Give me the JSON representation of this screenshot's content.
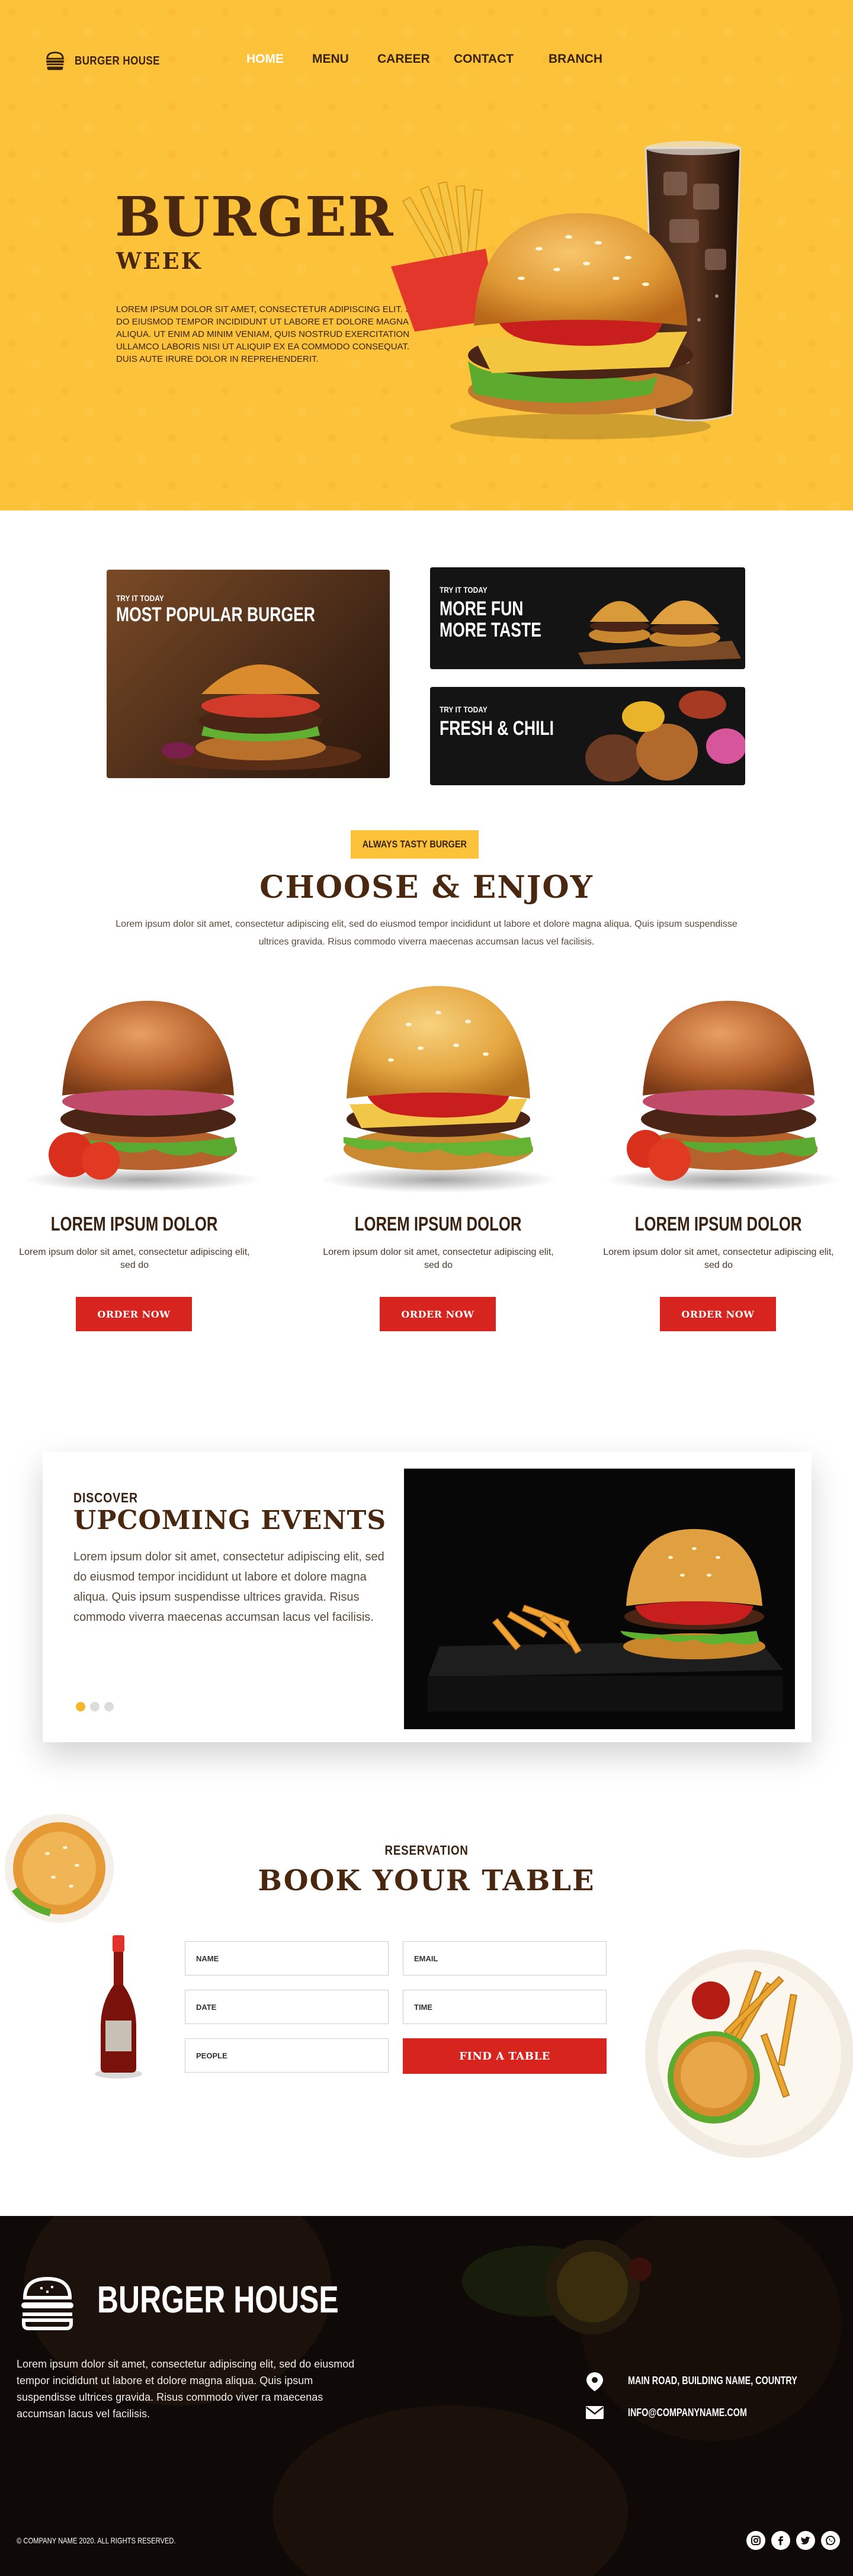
{
  "header": {
    "brand": "BURGER HOUSE",
    "nav": [
      {
        "label": "HOME",
        "active": true
      },
      {
        "label": "MENU",
        "active": false
      },
      {
        "label": "CAREER",
        "active": false
      },
      {
        "label": "CONTACT",
        "active": false
      },
      {
        "label": "BRANCH",
        "active": false
      }
    ]
  },
  "hero": {
    "title": "BURGER",
    "subtitle": "WEEK",
    "text": "LOREM IPSUM DOLOR SIT AMET, CONSECTETUR ADIPISCING ELIT. SED DO EIUSMOD TEMPOR INCIDIDUNT UT LABORE ET DOLORE MAGNA ALIQUA. UT ENIM AD MINIM VENIAM, QUIS NOSTRUD EXERCITATION ULLAMCO LABORIS NISI UT ALIQUIP EX EA COMMODO CONSEQUAT. DUIS AUTE IRURE DOLOR IN REPREHENDERIT."
  },
  "promos": [
    {
      "kicker": "TRY IT TODAY",
      "title": "MOST POPULAR BURGER"
    },
    {
      "kicker": "TRY IT TODAY",
      "title_line1": "MORE FUN",
      "title_line2": "MORE TASTE"
    },
    {
      "kicker": "TRY IT TODAY",
      "title": "FRESH & CHILI"
    }
  ],
  "choose": {
    "badge": "ALWAYS TASTY BURGER",
    "title": "CHOOSE & ENJOY",
    "text": "Lorem ipsum dolor sit amet, consectetur adipiscing elit, sed do eiusmod tempor incididunt ut labore et dolore magna aliqua. Quis ipsum suspendisse ultrices gravida. Risus commodo viverra maecenas accumsan lacus vel facilisis."
  },
  "products": [
    {
      "name": "LOREM IPSUM DOLOR",
      "desc": "Lorem ipsum dolor sit amet, consectetur adipiscing elit, sed do",
      "button": "ORDER NOW"
    },
    {
      "name": "LOREM IPSUM DOLOR",
      "desc": "Lorem ipsum dolor sit amet, consectetur adipiscing elit, sed do",
      "button": "ORDER NOW"
    },
    {
      "name": "LOREM IPSUM DOLOR",
      "desc": "Lorem ipsum dolor sit amet, consectetur adipiscing elit, sed do",
      "button": "ORDER NOW"
    }
  ],
  "events": {
    "kicker": "DISCOVER",
    "title": "UPCOMING EVENTS",
    "text": "Lorem ipsum dolor sit amet, consectetur adipiscing elit, sed do eiusmod tempor incididunt ut labore et dolore magna aliqua. Quis ipsum suspendisse ultrices gravida. Risus commodo viverra maecenas accumsan lacus vel facilisis.",
    "slides": 3,
    "active_slide": 1
  },
  "booking": {
    "kicker": "RESERVATION",
    "title": "BOOK YOUR TABLE",
    "fields": {
      "name": "NAME",
      "email": "EMAIL",
      "date": "DATE",
      "time": "TIME",
      "people": "PEOPLE"
    },
    "button": "FIND A TABLE"
  },
  "footer": {
    "brand": "BURGER HOUSE",
    "text": "Lorem ipsum dolor sit amet, consectetur adipiscing elit, sed do eiusmod tempor incididunt ut labore et dolore magna aliqua. Quis ipsum suspendisse ultrices gravida. Risus commodo viver ra maecenas accumsan lacus vel facilisis.",
    "address": "MAIN ROAD, BUILDING NAME, COUNTRY",
    "email": "INFO@COMPANYNAME.COM",
    "copyright": "© COMPANY NAME 2020. ALL RIGHTS RESERVED.",
    "social": [
      "instagram-icon",
      "facebook-icon",
      "twitter-icon",
      "whatsapp-icon"
    ]
  },
  "colors": {
    "accent_yellow": "#fcc33a",
    "brand_brown": "#4a2810",
    "action_red": "#d8241f",
    "footer_bg": "#1a120c"
  }
}
